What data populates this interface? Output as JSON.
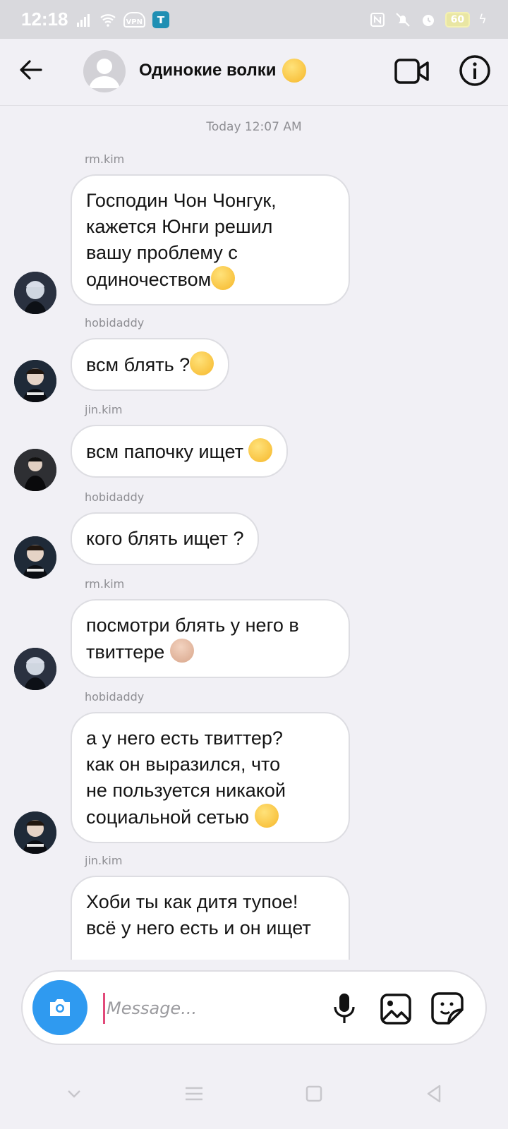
{
  "status_bar": {
    "time": "12:18",
    "vpn_label": "VPN",
    "battery_level": "60"
  },
  "header": {
    "chat_title": "Одинокие волки",
    "title_emoji": "face-with-raised-eyebrow"
  },
  "chat": {
    "timestamp": "Today 12:07 AM",
    "messages": [
      {
        "sender": "rm.kim",
        "text": "Господин Чон Чонгук,\nкажется Юнги решил\nвашу проблему с\nодиночеством",
        "emoji": "smirking-face"
      },
      {
        "sender": "hobidaddy",
        "text": "всм блять ?",
        "emoji": "face-with-raised-eyebrow"
      },
      {
        "sender": "jin.kim",
        "text": "всм папочку ищет ",
        "emoji": "face-savoring-food"
      },
      {
        "sender": "hobidaddy",
        "text": "кого блять ищет ?",
        "emoji": ""
      },
      {
        "sender": "rm.kim",
        "text": "посмотри блять у него в\nтвиттере ",
        "emoji": "person-facepalming"
      },
      {
        "sender": "hobidaddy",
        "text": "а у него есть твиттер?\nкак он выразился, что\nне пользуется никакой\nсоциальной сетью ",
        "emoji": "thinking-face"
      },
      {
        "sender": "jin.kim",
        "text": "Хоби ты как дитя тупое!\nвсё у него есть и он ищет",
        "emoji": ""
      }
    ]
  },
  "composer": {
    "placeholder": "Message..."
  },
  "colors": {
    "accent": "#2f9af0",
    "background": "#f1f0f5",
    "bubble": "#ffffff",
    "bubble_border": "#dddde2",
    "secondary_text": "#8e8e93"
  }
}
